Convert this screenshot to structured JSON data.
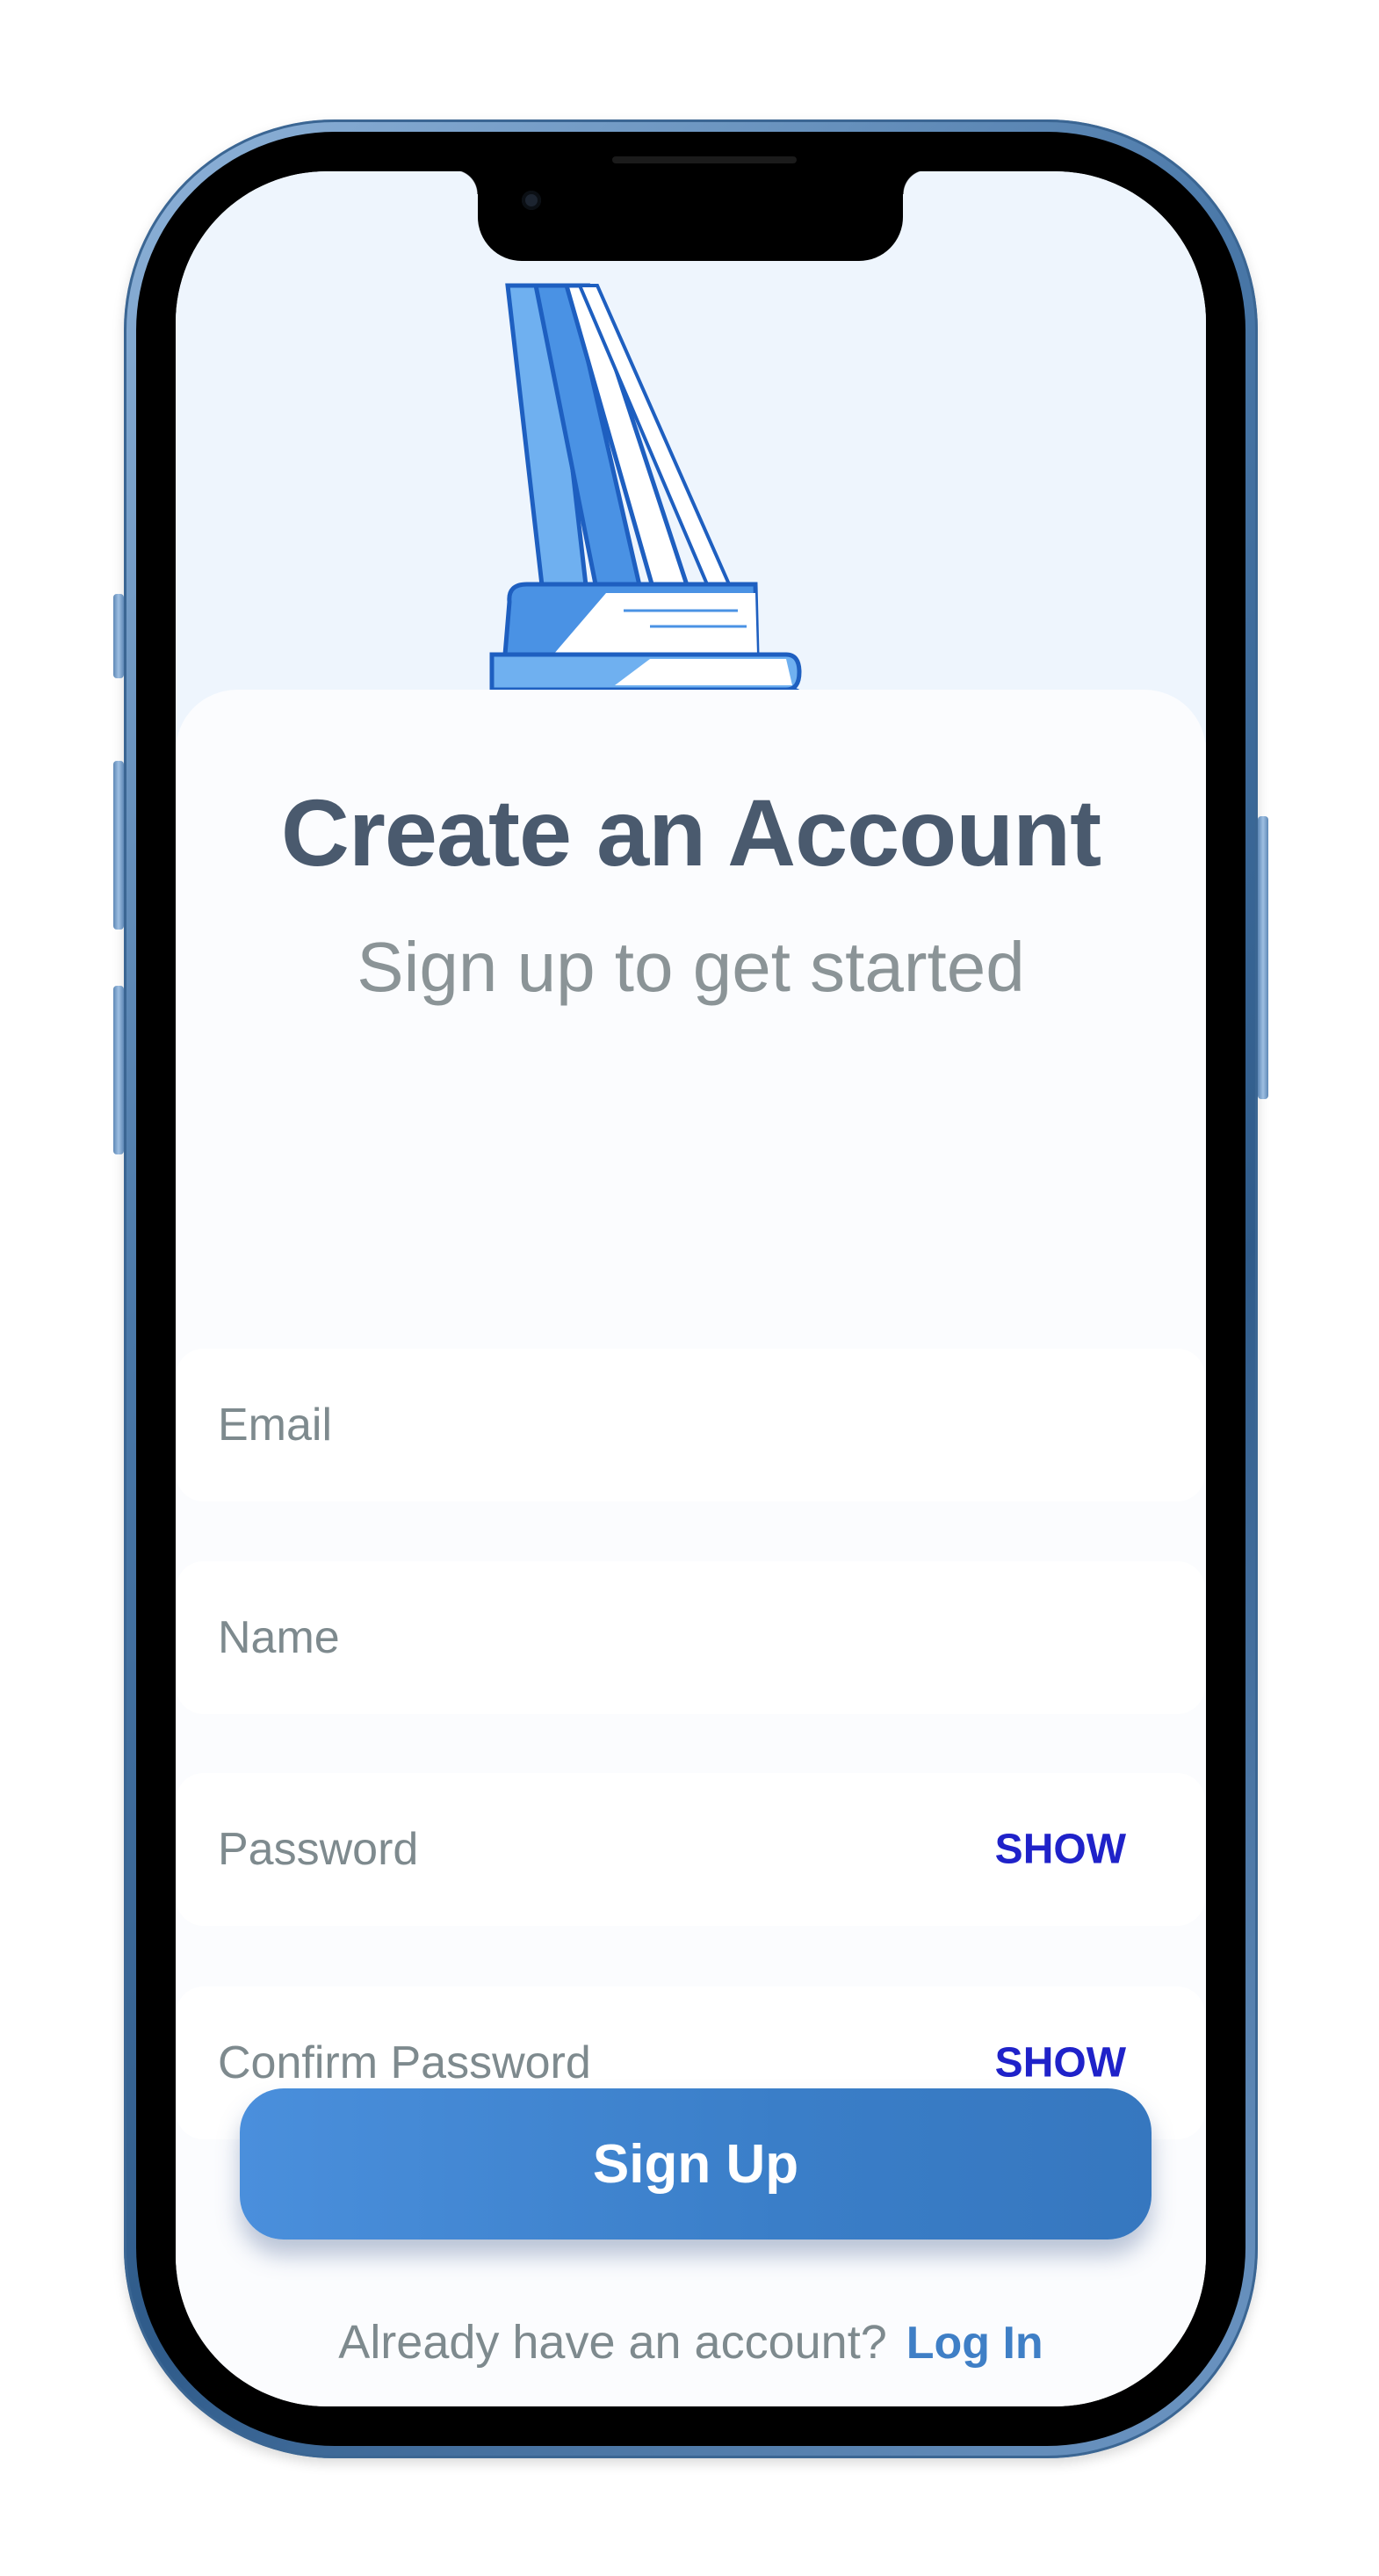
{
  "header": {
    "title": "Create an Account",
    "subtitle": "Sign up to get started"
  },
  "form": {
    "email_placeholder": "Email",
    "name_placeholder": "Name",
    "password_placeholder": "Password",
    "confirm_password_placeholder": "Confirm Password",
    "password_toggle_label": "SHOW",
    "confirm_password_toggle_label": "SHOW"
  },
  "actions": {
    "signup_label": "Sign Up",
    "login_prompt": "Already have an account?",
    "login_label": "Log In"
  },
  "illustration": {
    "icon": "books-stack-icon",
    "colors": {
      "light_blue": "#6fb0f0",
      "mid_blue": "#4a92e4",
      "dark_blue": "#1e5fc0",
      "white": "#ffffff"
    }
  },
  "theme": {
    "accent": "#3a7ec8",
    "link": "#3f7fc6",
    "show_toggle": "#1f22c9",
    "title_color": "#4a5a6e",
    "muted_text": "#7e8a8e",
    "device_frame": "#4a78a8"
  }
}
